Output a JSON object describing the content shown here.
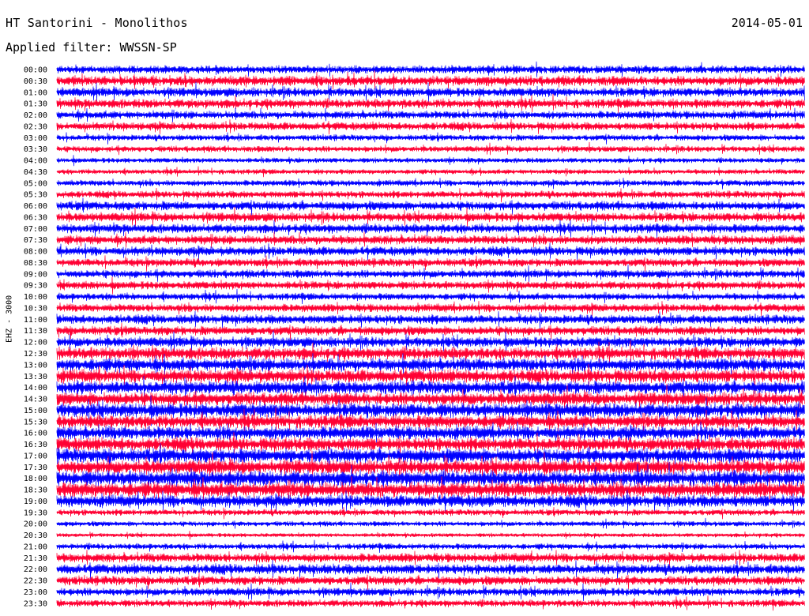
{
  "header": {
    "station": "HT Santorini - Monolithos",
    "date": "2014-05-01",
    "filter": "Applied filter: WWSSN-SP"
  },
  "channel": "EHZ - 3000",
  "colors": {
    "trace_a": "#0000ff",
    "trace_b": "#ff0033",
    "background": "#ffffff",
    "text": "#000000"
  },
  "chart_data": {
    "type": "line",
    "title": "HT Santorini - Monolithos",
    "subtitle": "Applied filter: WWSSN-SP",
    "ylabel": "EHZ - 3000",
    "xlabel": "",
    "grid": false,
    "rows": [
      {
        "label": "00:00",
        "amplitude": 0.8
      },
      {
        "label": "00:30",
        "amplitude": 1.0
      },
      {
        "label": "01:00",
        "amplitude": 0.9
      },
      {
        "label": "01:30",
        "amplitude": 0.9
      },
      {
        "label": "02:00",
        "amplitude": 0.8
      },
      {
        "label": "02:30",
        "amplitude": 0.8
      },
      {
        "label": "03:00",
        "amplitude": 0.6
      },
      {
        "label": "03:30",
        "amplitude": 0.6
      },
      {
        "label": "04:00",
        "amplitude": 0.5
      },
      {
        "label": "04:30",
        "amplitude": 0.5
      },
      {
        "label": "05:00",
        "amplitude": 0.6
      },
      {
        "label": "05:30",
        "amplitude": 0.7
      },
      {
        "label": "06:00",
        "amplitude": 0.9
      },
      {
        "label": "06:30",
        "amplitude": 0.9
      },
      {
        "label": "07:00",
        "amplitude": 0.9
      },
      {
        "label": "07:30",
        "amplitude": 0.9
      },
      {
        "label": "08:00",
        "amplitude": 0.9
      },
      {
        "label": "08:30",
        "amplitude": 0.8
      },
      {
        "label": "09:00",
        "amplitude": 0.8
      },
      {
        "label": "09:30",
        "amplitude": 0.8
      },
      {
        "label": "10:00",
        "amplitude": 0.7
      },
      {
        "label": "10:30",
        "amplitude": 0.8
      },
      {
        "label": "11:00",
        "amplitude": 0.9
      },
      {
        "label": "11:30",
        "amplitude": 0.9
      },
      {
        "label": "12:00",
        "amplitude": 1.0
      },
      {
        "label": "12:30",
        "amplitude": 1.2
      },
      {
        "label": "13:00",
        "amplitude": 1.3
      },
      {
        "label": "13:30",
        "amplitude": 1.3
      },
      {
        "label": "14:00",
        "amplitude": 1.3
      },
      {
        "label": "14:30",
        "amplitude": 1.3
      },
      {
        "label": "15:00",
        "amplitude": 1.4
      },
      {
        "label": "15:30",
        "amplitude": 1.3
      },
      {
        "label": "16:00",
        "amplitude": 1.3
      },
      {
        "label": "16:30",
        "amplitude": 1.3
      },
      {
        "label": "17:00",
        "amplitude": 1.4
      },
      {
        "label": "17:30",
        "amplitude": 1.4
      },
      {
        "label": "18:00",
        "amplitude": 1.5
      },
      {
        "label": "18:30",
        "amplitude": 1.5
      },
      {
        "label": "19:00",
        "amplitude": 1.2
      },
      {
        "label": "19:30",
        "amplitude": 0.6
      },
      {
        "label": "20:00",
        "amplitude": 0.5
      },
      {
        "label": "20:30",
        "amplitude": 0.4
      },
      {
        "label": "21:00",
        "amplitude": 0.6
      },
      {
        "label": "21:30",
        "amplitude": 0.9
      },
      {
        "label": "22:00",
        "amplitude": 1.0
      },
      {
        "label": "22:30",
        "amplitude": 0.9
      },
      {
        "label": "23:00",
        "amplitude": 0.8
      },
      {
        "label": "23:30",
        "amplitude": 0.7
      }
    ]
  }
}
